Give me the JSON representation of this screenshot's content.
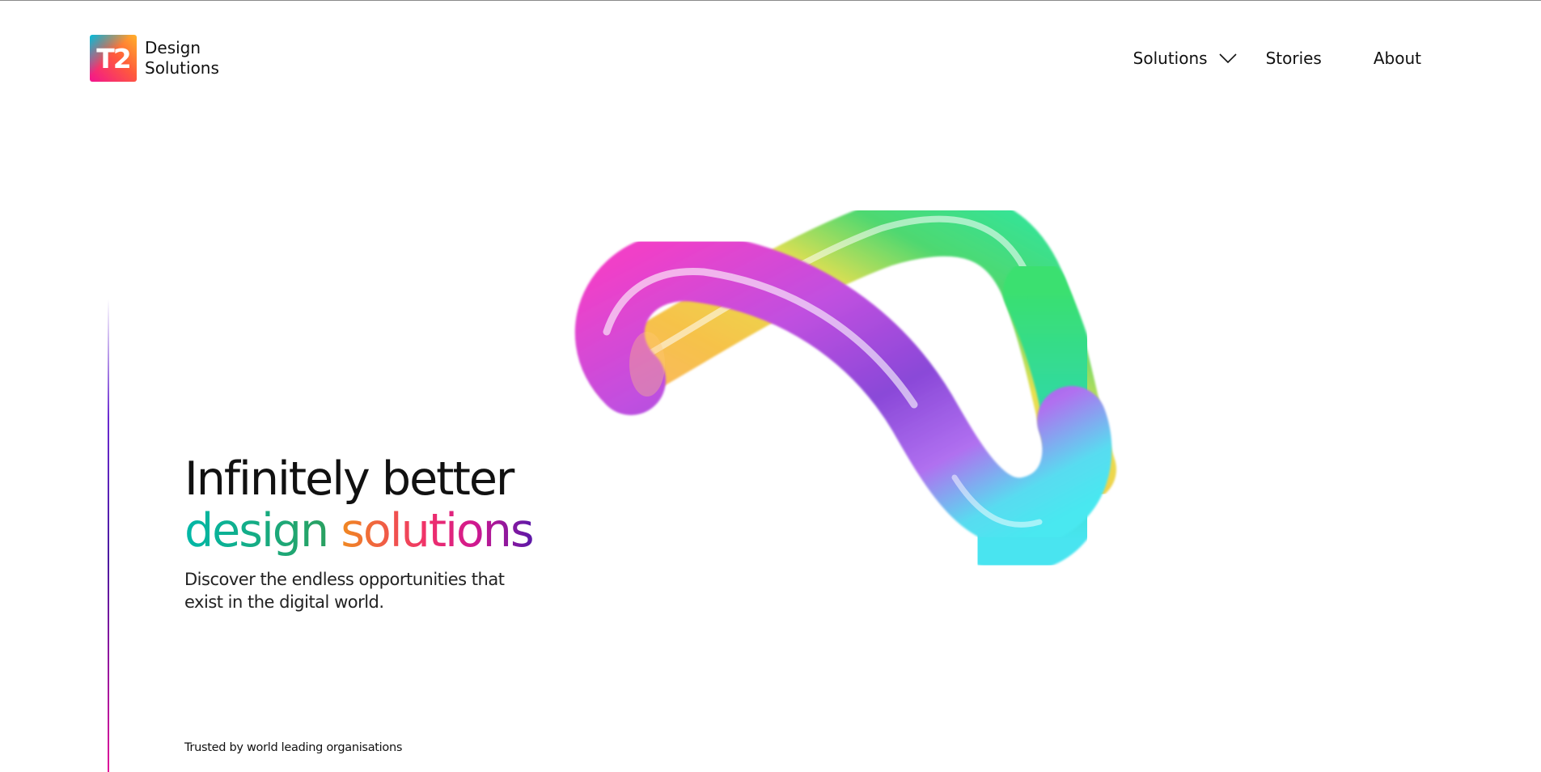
{
  "logo": {
    "mark_text": "T2",
    "line1": "Design",
    "line2": "Solutions"
  },
  "nav": {
    "items": [
      {
        "label": "Solutions",
        "has_dropdown": true,
        "icon": "chevron-down-icon"
      },
      {
        "label": "Stories"
      },
      {
        "label": "About"
      }
    ]
  },
  "hero": {
    "headline_line1": "Infinitely better",
    "headline_word1": "design",
    "headline_word2": "solutions",
    "subtitle": "Discover the endless opportunities that exist in the digital world.",
    "art_icon": "infinity-loop-icon"
  },
  "footer": {
    "trusted_text": "Trusted by world leading organisations"
  },
  "colors": {
    "text": "#111111",
    "background": "#ffffff",
    "accent_teal": "#00b8a8",
    "accent_orange": "#f08a20",
    "accent_pink": "#d01890",
    "accent_purple": "#5a18a8"
  }
}
